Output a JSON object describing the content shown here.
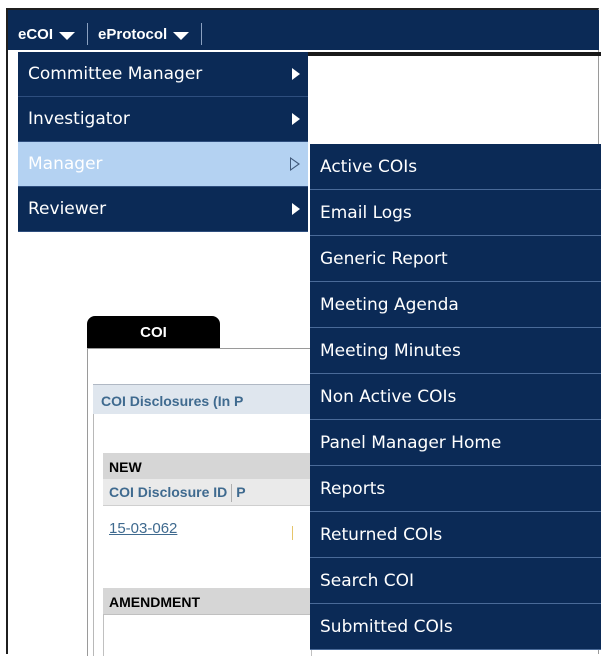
{
  "topnav": [
    {
      "label": "eCOI"
    },
    {
      "label": "eProtocol"
    }
  ],
  "menu_primary": [
    {
      "label": "Committee Manager",
      "active": false
    },
    {
      "label": "Investigator",
      "active": false
    },
    {
      "label": "Manager",
      "active": true
    },
    {
      "label": "Reviewer",
      "active": false
    }
  ],
  "menu_sub": [
    {
      "label": "Active COIs"
    },
    {
      "label": "Email Logs"
    },
    {
      "label": "Generic Report"
    },
    {
      "label": "Meeting Agenda"
    },
    {
      "label": "Meeting Minutes"
    },
    {
      "label": "Non Active COIs"
    },
    {
      "label": "Panel Manager Home"
    },
    {
      "label": "Reports"
    },
    {
      "label": "Returned COIs"
    },
    {
      "label": "Search COI"
    },
    {
      "label": "Submitted COIs"
    }
  ],
  "page": {
    "tab_label": "COI",
    "panel_title": "COI Disclosures (In P",
    "section_new": "NEW",
    "col_disclosure_id": "COI Disclosure ID",
    "col_next": "P",
    "row_id": "15-03-062",
    "section_amendment": "AMENDMENT"
  },
  "colors": {
    "nav_bg": "#0b2a56",
    "active_item_bg": "#b4d2f2",
    "link": "#3f6a8f"
  }
}
